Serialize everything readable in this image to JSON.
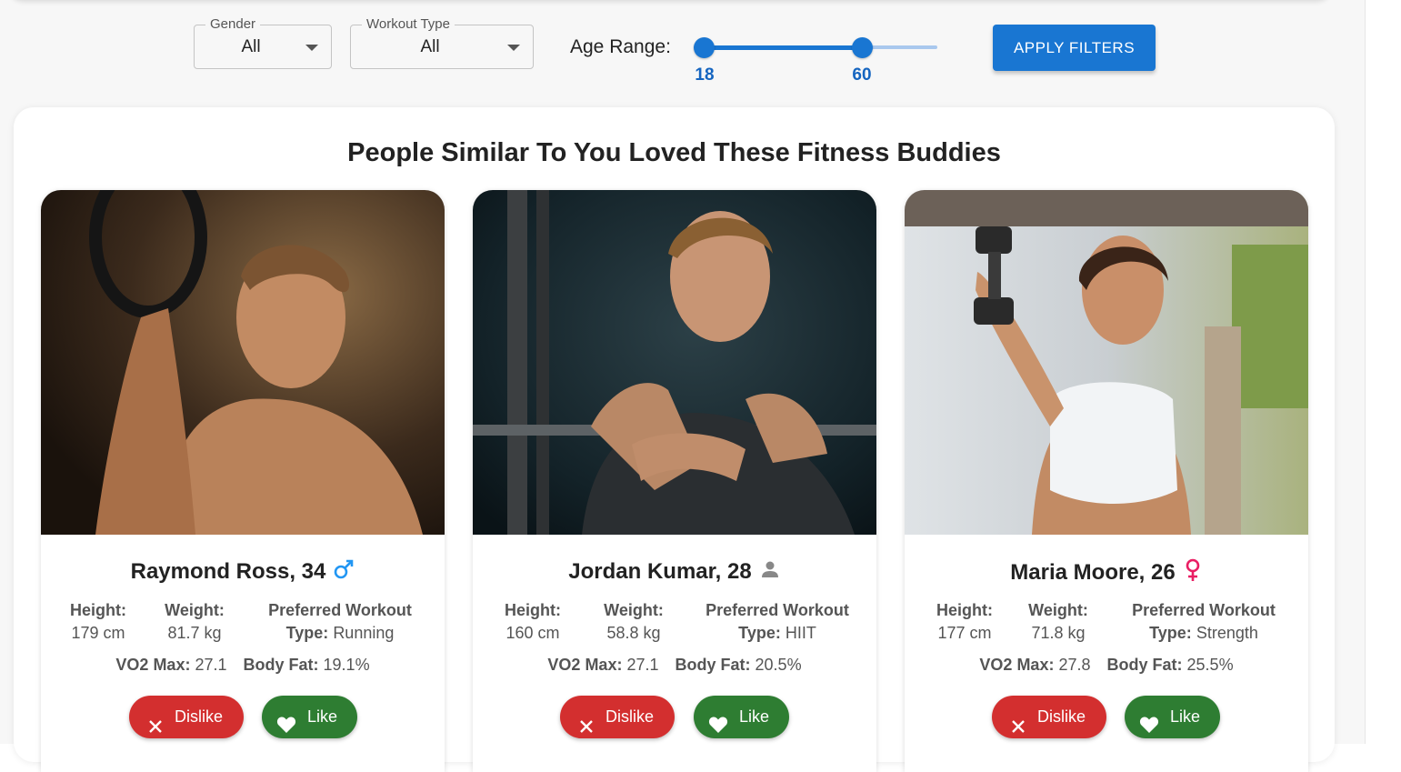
{
  "filters": {
    "gender": {
      "label": "Gender",
      "value": "All"
    },
    "workout_type": {
      "label": "Workout Type",
      "value": "All"
    },
    "age_range": {
      "label": "Age Range:",
      "min": 18,
      "max": 60,
      "min_text": "18",
      "max_text": "60"
    },
    "apply_label": "APPLY FILTERS"
  },
  "section_title": "People Similar To You Loved These Fitness Buddies",
  "labels": {
    "height": "Height:",
    "weight": "Weight:",
    "workout_1": "Preferred Workout",
    "workout_2": "Type:",
    "vo2": "VO2 Max:",
    "bodyfat": "Body Fat:",
    "dislike": "Dislike",
    "like": "Like"
  },
  "colors": {
    "primary": "#1976d2",
    "dislike": "#d32f2f",
    "like": "#2e7d32",
    "male_icon": "#2196f3",
    "female_icon": "#e91e63",
    "neutral_icon": "#888888"
  },
  "buddies": [
    {
      "name": "Raymond Ross, 34",
      "gender_icon": "male-icon",
      "height": "179 cm",
      "weight": "81.7 kg",
      "workout": "Running",
      "vo2": "27.1",
      "bodyfat": "19.1%"
    },
    {
      "name": "Jordan Kumar, 28",
      "gender_icon": "person-icon",
      "height": "160 cm",
      "weight": "58.8 kg",
      "workout": "HIIT",
      "vo2": "27.1",
      "bodyfat": "20.5%"
    },
    {
      "name": "Maria Moore, 26",
      "gender_icon": "female-icon",
      "height": "177 cm",
      "weight": "71.8 kg",
      "workout": "Strength",
      "vo2": "27.8",
      "bodyfat": "25.5%"
    }
  ]
}
